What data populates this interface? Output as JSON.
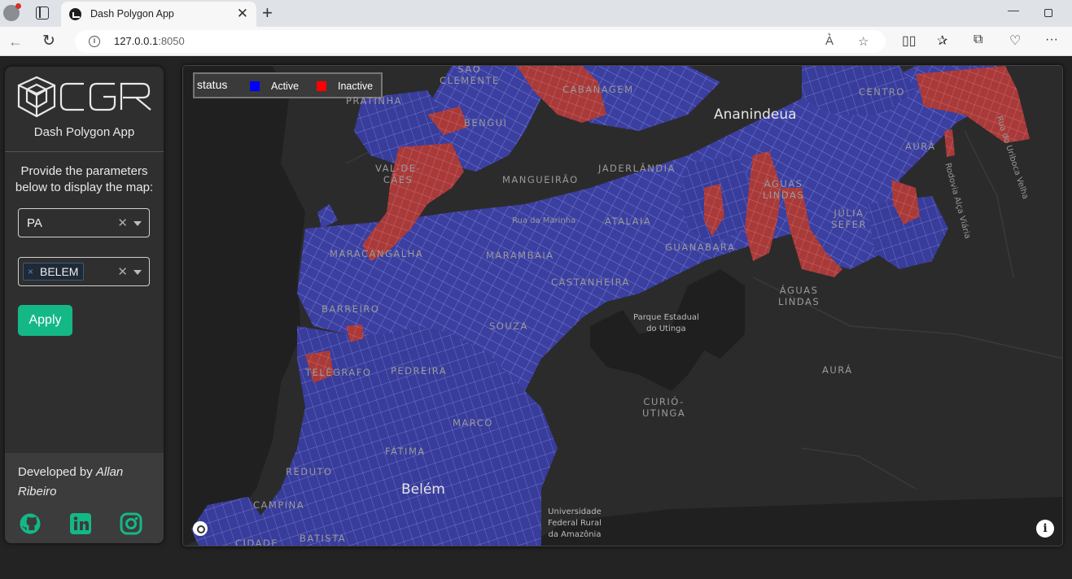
{
  "browser": {
    "tab_title": "Dash Polygon App",
    "url_host": "127.0.0.1",
    "url_port": ":8050"
  },
  "sidebar": {
    "logo_text": "CGR",
    "app_title": "Dash Polygon App",
    "instructions": "Provide the parameters below to display the map:",
    "state_select": {
      "value": "PA"
    },
    "city_select": {
      "chips": [
        "BELEM"
      ]
    },
    "apply_label": "Apply",
    "footer": {
      "developed_by": "Developed by ",
      "author": "Allan Ribeiro"
    },
    "social_icons": [
      "github-icon",
      "linkedin-icon",
      "instagram-icon"
    ]
  },
  "map": {
    "legend": {
      "title": "status",
      "items": [
        {
          "label": "Active",
          "color": "#0000ff"
        },
        {
          "label": "Inactive",
          "color": "#ff0000"
        }
      ]
    },
    "labels": {
      "sao_clemente": "SÃO\nCLEMENTE",
      "pratinha": "PRATINHA",
      "cabanagem": "CABANAGEM",
      "ananindeua": "Ananindeua",
      "centro": "CENTRO",
      "bengui": "BENGUI",
      "val_de_caes": "VAL-DE-\nCÃES",
      "mangueirao": "MANGUEIRÃO",
      "jaderlandia": "JADERLÂNDIA",
      "aguas_lindas_1": "ÁGUAS\nLINDAS",
      "aura_1": "AURÁ",
      "julia_sefer": "JÚLIA\nSEFER",
      "rua_da_marinha": "Rua da Marinha",
      "atalaia": "ATALAIA",
      "guanabara": "GUANABARA",
      "maracangalha": "MARACANGALHA",
      "marambaia": "MARAMBAIA",
      "castanheira": "CASTANHEIRA",
      "aguas_lindas_2": "ÁGUAS\nLINDAS",
      "barreiro": "BARREIRO",
      "parque_utinga": "Parque Estadual\ndo Utinga",
      "souza": "SOUZA",
      "telegrafo": "TELÉGRAFO",
      "pedreira": "PEDREIRA",
      "aura_2": "AURÁ",
      "curio_utinga": "CURIÓ-\nUTINGA",
      "marco": "MARCO",
      "fatima": "FÁTIMA",
      "reduto": "REDUTO",
      "belem": "Belém",
      "campina": "CAMPINA",
      "universidade": "Universidade\nFederal Rural\nda Amazônia",
      "batista": "BATISTA",
      "cidade": "CIDADE",
      "rodovia": "Rodovia Alça Viária",
      "rua_uriboca": "Rua do Uriboca Velha"
    },
    "colors": {
      "active_fill": "#3b3fa0",
      "inactive_fill": "#a83a3a",
      "background": "#2b2b2b",
      "water": "#202020"
    }
  }
}
